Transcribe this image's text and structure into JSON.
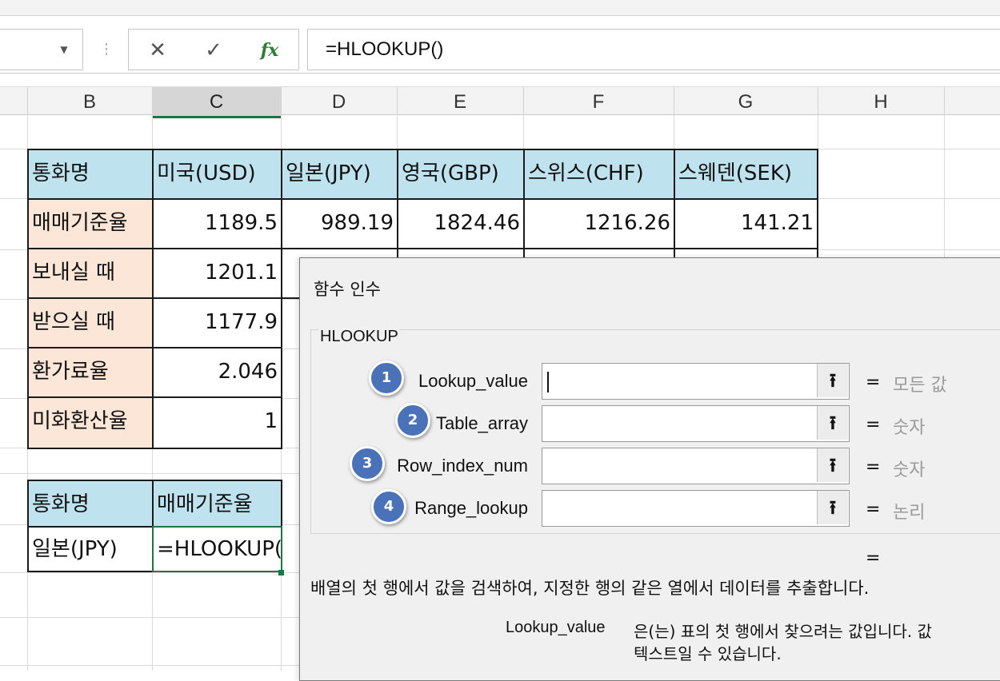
{
  "formula_bar": {
    "cancel_icon": "✕",
    "enter_icon": "✓",
    "fx_label": "fx",
    "formula": "=HLOOKUP()"
  },
  "columns": [
    "B",
    "C",
    "D",
    "E",
    "F",
    "G",
    "H"
  ],
  "active_column": "C",
  "table1": {
    "headers": [
      "통화명",
      "미국(USD)",
      "일본(JPY)",
      "영국(GBP)",
      "스위스(CHF)",
      "스웨덴(SEK)"
    ],
    "rows": [
      {
        "label": "매매기준율",
        "values": [
          "1189.5",
          "989.19",
          "1824.46",
          "1216.26",
          "141.21"
        ]
      },
      {
        "label": "보내실 때",
        "values": [
          "1201.1"
        ]
      },
      {
        "label": "받으실 때",
        "values": [
          "1177.9"
        ]
      },
      {
        "label": "환가료율",
        "values": [
          "2.046"
        ]
      },
      {
        "label": "미화환산율",
        "values": [
          "1"
        ]
      }
    ]
  },
  "table2": {
    "headers": [
      "통화명",
      "매매기준율"
    ],
    "row_label": "일본(JPY)",
    "active_cell_text": "=HLOOKUP()"
  },
  "dialog": {
    "title": "함수 인수",
    "function_name": "HLOOKUP",
    "args": [
      {
        "num": "1",
        "name": "Lookup_value",
        "type": "모든 값"
      },
      {
        "num": "2",
        "name": "Table_array",
        "type": "숫자"
      },
      {
        "num": "3",
        "name": "Row_index_num",
        "type": "숫자"
      },
      {
        "num": "4",
        "name": "Range_lookup",
        "type": "논리"
      }
    ],
    "equals": "=",
    "collapse_icon": "⭱",
    "description": "배열의 첫 행에서 값을 검색하여, 지정한 행의 같은 열에서 데이터를 추출합니다.",
    "arg_help_name": "Lookup_value",
    "arg_help_line1": "은(는) 표의 첫 행에서 찾으려는 값입니다. 값",
    "arg_help_line2": "텍스트일 수 있습니다."
  }
}
